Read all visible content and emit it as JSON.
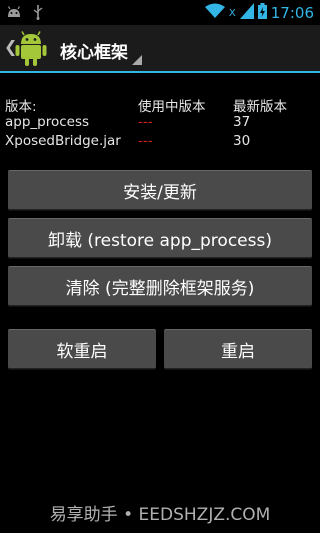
{
  "status_bar": {
    "time": "17:06",
    "network_label": "X",
    "icons": [
      "android-debug-icon",
      "usb-icon",
      "wifi-icon",
      "signal-icon",
      "battery-icon"
    ],
    "accent_color": "#33b5e5"
  },
  "action_bar": {
    "title": "核心框架",
    "logo_icon": "android-robot-icon",
    "back_icon": "chevron-left-icon"
  },
  "info": {
    "header": {
      "label": "版本:",
      "active": "使用中版本",
      "latest": "最新版本"
    },
    "rows": [
      {
        "name": "app_process",
        "active": "---",
        "latest": "37"
      },
      {
        "name": "XposedBridge.jar",
        "active": "---",
        "latest": "30"
      }
    ]
  },
  "buttons": {
    "install": "安装/更新",
    "uninstall": "卸载 (restore app_process)",
    "clean": "清除 (完整删除框架服务)",
    "soft_reboot": "软重启",
    "reboot": "重启"
  },
  "watermark": "易享助手 • EEDSHZJZ.COM"
}
